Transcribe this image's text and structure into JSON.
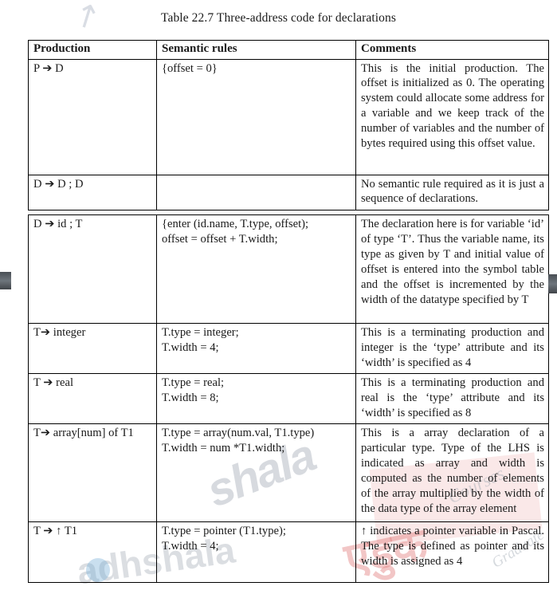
{
  "document": {
    "caption": "Table 22.7 Three-address code for declarations"
  },
  "table": {
    "headers": {
      "production": "Production",
      "semantic_rules": "Semantic rules",
      "comments": "Comments"
    },
    "part1_rows": [
      {
        "production": "P ➔ D",
        "semantic_rules": "{offset = 0}",
        "comments": "This is the initial production. The offset is initialized as 0. The operating system could allocate some address for a variable and we keep track of the number of variables and the number of bytes required using this offset value."
      },
      {
        "production": "D ➔ D ; D",
        "semantic_rules": "",
        "comments": "No semantic rule required as it is just a sequence of declarations."
      }
    ],
    "part2_rows": [
      {
        "production": "D ➔ id ; T",
        "semantic_rules": "{enter (id.name, T.type, offset);\noffset = offset + T.width;",
        "comments": "The declaration here is for variable ‘id’ of type ‘T’. Thus the variable name, its type as given by T and initial value of offset is entered into the symbol table and the offset is incremented by the width of the datatype specified by T"
      },
      {
        "production": "T➔ integer",
        "semantic_rules": "T.type = integer;\nT.width = 4;",
        "comments": "This is a terminating production and integer is the ‘type’ attribute and its ‘width’ is specified as 4"
      },
      {
        "production": "T ➔ real",
        "semantic_rules": "T.type = real;\nT.width = 8;",
        "comments": "This is a terminating production and real is the ‘type’ attribute and its ‘width’ is specified as 8"
      },
      {
        "production": "T➔ array[num] of T1",
        "semantic_rules": "T.type = array(num.val, T1.type)\nT.width = num *T1.width;",
        "comments": "This is a array declaration of a particular type. Type of the LHS is indicated as array and width is computed as the number of elements of the array multiplied by the width of the data type of the array element"
      },
      {
        "production": "T ➔ ↑ T1",
        "semantic_rules": "T.type = pointer (T1.type);\nT.width = 4;",
        "comments": "↑ indicates a pointer variable in Pascal. The type is defined as pointer and its width is assigned as 4"
      }
    ]
  },
  "watermarks": {
    "top_mark": "↗",
    "diagonal_brand": "shala",
    "brand": "adhshala",
    "hindi": "एडुक",
    "courses": "Courses",
    "graduate": "Graduate"
  }
}
